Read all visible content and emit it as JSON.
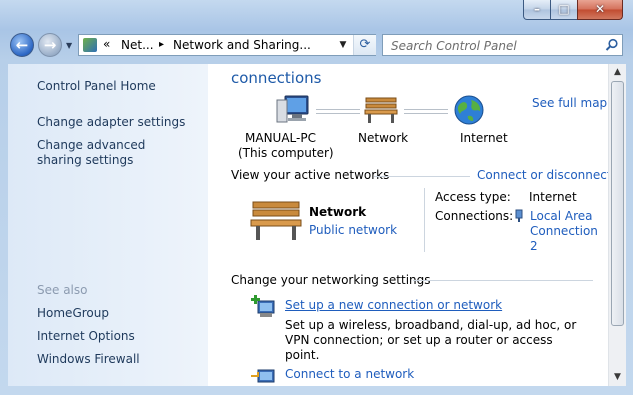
{
  "window": {
    "minimize_glyph": "–",
    "maximize_glyph": "□",
    "close_glyph": "✕"
  },
  "address_bar": {
    "overflow_glyph": "«",
    "crumbs": [
      "Net...",
      "Network and Sharing..."
    ],
    "separator_glyph": "▸",
    "dropdown_glyph": "▼",
    "refresh_glyph": "⟳"
  },
  "search": {
    "placeholder": "Search Control Panel"
  },
  "sidebar": {
    "home": "Control Panel Home",
    "links": [
      "Change adapter settings",
      "Change advanced sharing settings"
    ],
    "see_also_label": "See also",
    "see_also": [
      "HomeGroup",
      "Internet Options",
      "Windows Firewall"
    ]
  },
  "network_map": {
    "heading": "connections",
    "see_full_map": "See full map",
    "nodes": [
      {
        "label": "MANUAL-PC",
        "sub": "(This computer)",
        "icon": "computer-icon"
      },
      {
        "label": "Network",
        "icon": "bench-icon"
      },
      {
        "label": "Internet",
        "icon": "globe-icon"
      }
    ]
  },
  "active_networks": {
    "label": "View your active networks",
    "action": "Connect or disconnect",
    "network_name": "Network",
    "network_type": "Public network",
    "access_type_label": "Access type:",
    "access_type_value": "Internet",
    "connections_label": "Connections:",
    "connection_value": "Local Area Connection 2"
  },
  "settings": {
    "label": "Change your networking settings",
    "items": [
      {
        "title": "Set up a new connection or network",
        "desc": "Set up a wireless, broadband, dial-up, ad hoc, or VPN connection; or set up a router or access point."
      },
      {
        "title": "Connect to a network"
      }
    ]
  },
  "colors": {
    "link": "#1f5dbd",
    "heading": "#1e5aa8",
    "sidebar_text": "#1e395b"
  }
}
